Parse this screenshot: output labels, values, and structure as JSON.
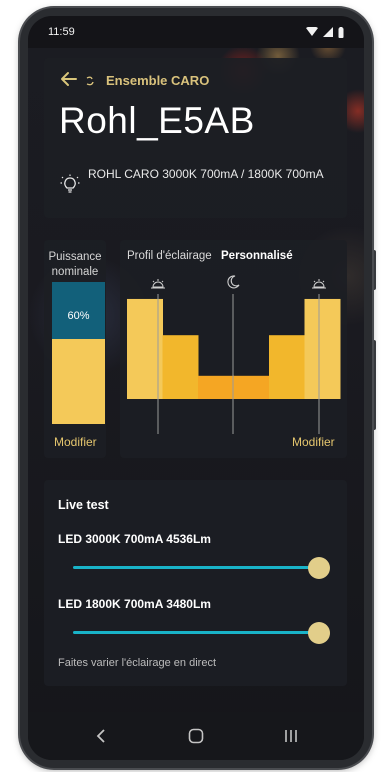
{
  "status_bar": {
    "time": "11:59"
  },
  "header": {
    "ensemble_label": "Ensemble CARO",
    "device_name": "Rohl_E5AB",
    "description": "ROHL CARO  3000K 700mA / 1800K 700mA"
  },
  "power": {
    "label": "Puissance nominale",
    "value_label": "60%",
    "fraction": 0.6,
    "modify_label": "Modifier"
  },
  "profile": {
    "label": "Profil d'éclairage",
    "mode": "Personnalisé",
    "modify_label": "Modifier",
    "segments": [
      {
        "level": 0.69,
        "color": "#f4c959"
      },
      {
        "level": 0.44,
        "color": "#f2b72c"
      },
      {
        "level": 0.16,
        "color": "#f5a623"
      },
      {
        "level": 0.16,
        "color": "#f5a623"
      },
      {
        "level": 0.44,
        "color": "#f2b72c"
      },
      {
        "level": 0.69,
        "color": "#f4c959"
      }
    ]
  },
  "live_test": {
    "title": "Live test",
    "leds": [
      {
        "label": "LED 3000K 700mA 4536Lm",
        "value": 1.0
      },
      {
        "label": "LED 1800K 700mA 3480Lm",
        "value": 1.0
      }
    ],
    "hint": "Faites varier l'éclairage en direct"
  },
  "colors": {
    "accent_gold": "#e5c66e",
    "slider_cyan": "#19b3c8",
    "power_teal": "#12607a"
  },
  "icons": {
    "back": "arrow-left-icon",
    "bulb": "lightbulb-icon",
    "sunrise": "sunrise-icon",
    "moon": "moon-icon",
    "sunset": "sunset-icon"
  }
}
